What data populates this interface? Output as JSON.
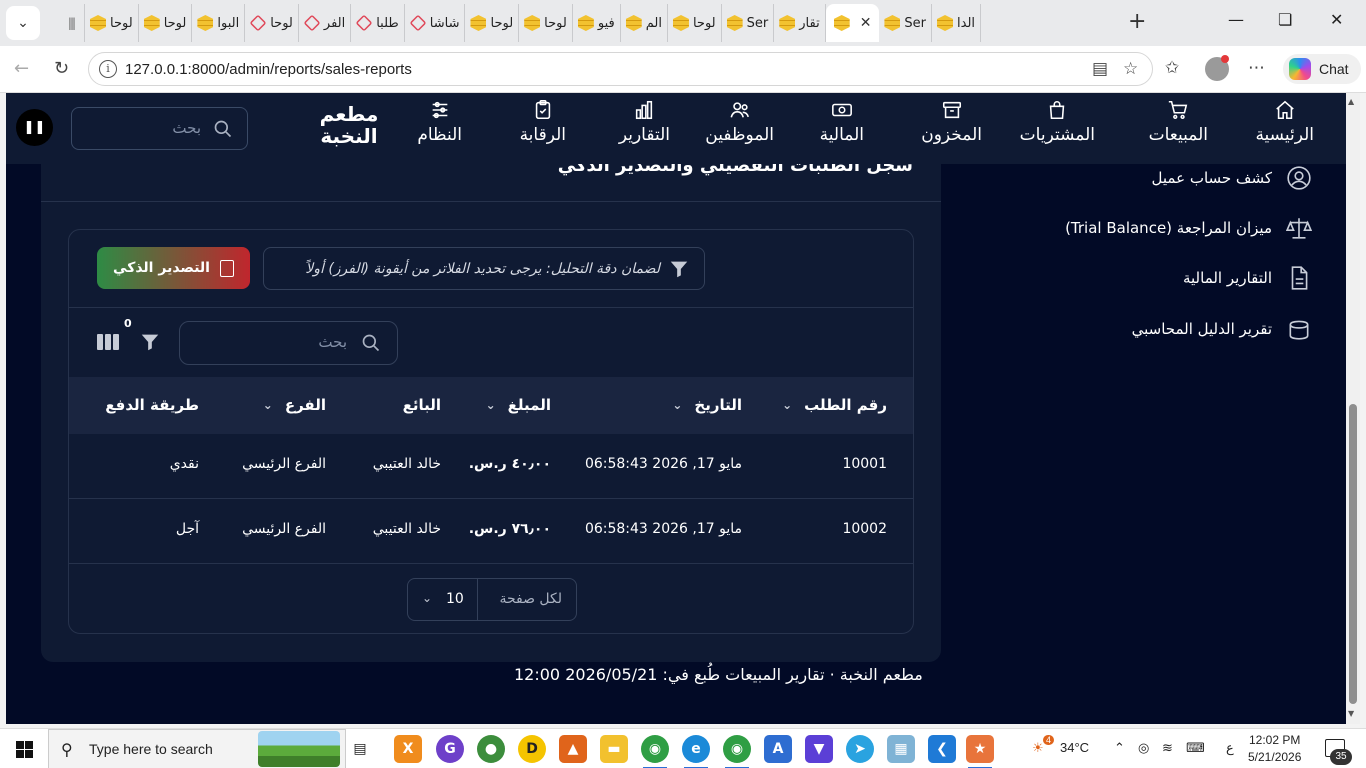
{
  "browser": {
    "tabs": [
      {
        "icon": "bars-icon",
        "title": ""
      },
      {
        "icon": "stack-icon",
        "title": "لوحا"
      },
      {
        "icon": "stack-icon",
        "title": "لوحا"
      },
      {
        "icon": "stack-icon",
        "title": "البوا"
      },
      {
        "icon": "laravel-icon",
        "title": "لوحا"
      },
      {
        "icon": "laravel-icon",
        "title": "الفر"
      },
      {
        "icon": "laravel-icon",
        "title": "طلبا"
      },
      {
        "icon": "laravel-icon",
        "title": "شاشا"
      },
      {
        "icon": "stack-icon",
        "title": "لوحا"
      },
      {
        "icon": "stack-icon",
        "title": "لوحا"
      },
      {
        "icon": "stack-icon",
        "title": "فيو"
      },
      {
        "icon": "stack-icon",
        "title": "الم"
      },
      {
        "icon": "stack-icon",
        "title": "لوحا"
      },
      {
        "icon": "stack-icon",
        "title": "Ser"
      },
      {
        "icon": "stack-icon",
        "title": "تقار"
      }
    ],
    "active_tab_title": "",
    "tabs_after": [
      {
        "icon": "stack-icon",
        "title": "Ser"
      },
      {
        "icon": "stack-icon",
        "title": "الدا"
      }
    ],
    "url": "127.0.0.1:8000/admin/reports/sales-reports",
    "copilot_label": "Chat"
  },
  "app": {
    "brand": "مطعم\nالنخبة",
    "nav": [
      {
        "label": "الرئيسية",
        "icon": "home-icon"
      },
      {
        "label": "المبيعات",
        "icon": "cart-icon"
      },
      {
        "label": "المشتريات",
        "icon": "bag-icon"
      },
      {
        "label": "المخزون",
        "icon": "archive-icon"
      },
      {
        "label": "المالية",
        "icon": "cash-icon"
      },
      {
        "label": "الموظفين",
        "icon": "users-icon"
      },
      {
        "label": "التقارير",
        "icon": "chart-icon"
      },
      {
        "label": "الرقابة",
        "icon": "clipboard-icon"
      },
      {
        "label": "النظام",
        "icon": "sliders-icon"
      }
    ],
    "nav_search_placeholder": "بحث",
    "sidebar": [
      {
        "label": "كشف حساب عميل",
        "icon": "user-circle-icon"
      },
      {
        "label": "ميزان المراجعة (Trial Balance)",
        "icon": "scale-icon"
      },
      {
        "label": "التقارير المالية",
        "icon": "document-icon"
      },
      {
        "label": "تقرير الدليل المحاسبي",
        "icon": "database-icon"
      }
    ],
    "card_title": "سجل الطلبات التفصيلي والتصدير الذكي",
    "notice": "لضمان دقة التحليل: يرجى تحديد الفلاتر من أيقونة (الفرز) أولاً",
    "export_label": "التصدير الذكي",
    "table_search_placeholder": "بحث",
    "filter_count": "0",
    "columns": [
      "رقم الطلب",
      "التاريخ",
      "المبلغ",
      "البائع",
      "الفرع",
      "طريقة الدفع"
    ],
    "rows": [
      [
        "10001",
        "مايو 17, 2026 06:58:43",
        "٤٠٫٠٠ ر.س.",
        "خالد العتيبي",
        "الفرع الرئيسي",
        "نقدي"
      ],
      [
        "10002",
        "مايو 17, 2026 06:58:43",
        "٧٦٫٠٠ ر.س.",
        "خالد العتيبي",
        "الفرع الرئيسي",
        "آجل"
      ]
    ],
    "per_page_label": "لكل صفحة",
    "per_page_value": "10",
    "footer": "مطعم النخبة · تقارير المبيعات طُبع في: 2026/05/21 12:00"
  },
  "taskbar": {
    "search_text": "Type here to search",
    "weather": "34°C",
    "weather_badge": "4",
    "lang": "ع",
    "time": "12:02 PM",
    "date": "5/21/2026",
    "notifications": "35"
  },
  "colors": {
    "app_bg": "#020a26",
    "panel_bg": "#0f1a33",
    "export_start": "#c0262d",
    "export_end": "#2e8b45"
  }
}
